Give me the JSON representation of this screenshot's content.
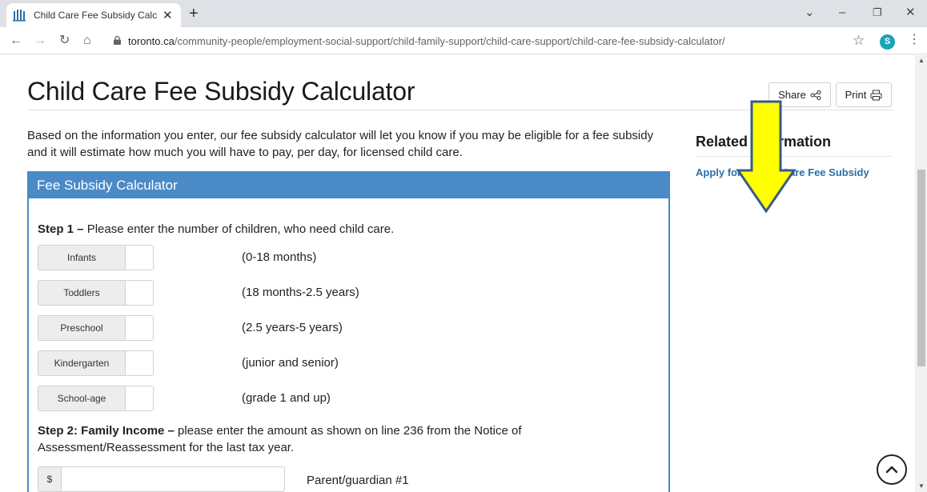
{
  "browser": {
    "tab_title": "Child Care Fee Subsidy Calculator",
    "tab_close": "✕",
    "new_tab": "+",
    "url_host": "toronto.ca",
    "url_path": "/community-people/employment-social-support/child-family-support/child-care-support/child-care-fee-subsidy-calculator/",
    "profile_initial": "S",
    "window_controls": {
      "dropdown": "⌄",
      "minimize": "–",
      "restore": "❐",
      "close": "✕"
    }
  },
  "page": {
    "title": "Child Care Fee Subsidy Calculator",
    "share_label": "Share",
    "print_label": "Print",
    "intro": "Based on the information you enter, our fee subsidy calculator will let you know if you may be eligible for a fee subsidy and it will estimate how much you will have to pay, per day, for licensed child care."
  },
  "related": {
    "title": "Related Information",
    "link": "Apply for a Child Care Fee Subsidy"
  },
  "calculator": {
    "header": "Fee Subsidy Calculator",
    "step1_bold": "Step 1 –",
    "step1_text": " Please enter the number of children, who need child care.",
    "children": [
      {
        "label": "Infants",
        "range": "(0-18 months)",
        "value": ""
      },
      {
        "label": "Toddlers",
        "range": "(18 months-2.5 years)",
        "value": ""
      },
      {
        "label": "Preschool",
        "range": "(2.5 years-5 years)",
        "value": ""
      },
      {
        "label": "Kindergarten",
        "range": "(junior and senior)",
        "value": ""
      },
      {
        "label": "School-age",
        "range": "(grade 1 and up)",
        "value": ""
      }
    ],
    "step2_bold": "Step 2: Family Income –",
    "step2_text": " please enter the amount as shown on line 236 from the Notice of Assessment/Reassessment for the last tax year.",
    "income_prefix": "$",
    "income_value": "",
    "income_label": "Parent/guardian #1"
  },
  "colors": {
    "accent": "#4a8ac6",
    "link": "#2c6ea7",
    "annotation_arrow": "#ffff00",
    "annotation_outline": "#3b5a8c"
  }
}
